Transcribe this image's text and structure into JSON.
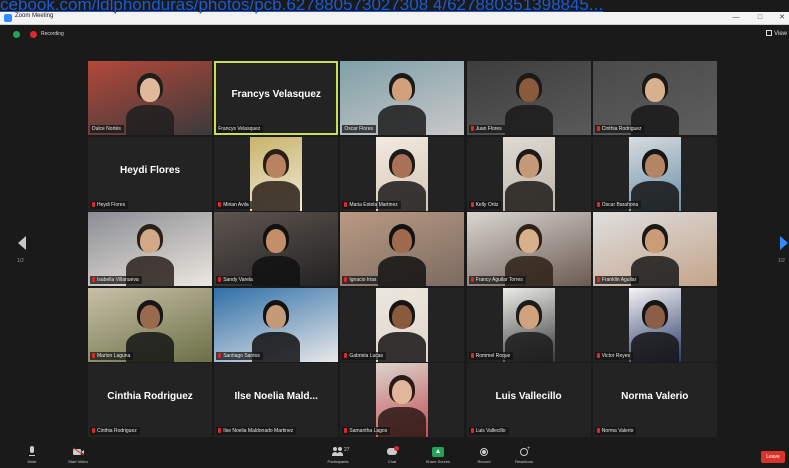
{
  "url_overlay": "cebook.com/ldlphonduras/photos/pcb.627880573027308 4/627880351398845...",
  "window": {
    "title": "Zoom Meeting",
    "min": "—",
    "max": "□",
    "close": "✕"
  },
  "topbar": {
    "recording": "Recording",
    "view": "View"
  },
  "pages": {
    "left": "1/2",
    "right": "1/2"
  },
  "participants": [
    {
      "name": "Dulce Nortés",
      "video": true,
      "muted": false
    },
    {
      "name": "Francys Velasquez",
      "display": "Francys Velasquez",
      "video": false,
      "muted": false,
      "active": true
    },
    {
      "name": "Oscar Flores",
      "video": true,
      "muted": false
    },
    {
      "name": "Juan Flores",
      "video": true,
      "muted": true
    },
    {
      "name": "Cinthia Rodriguez",
      "video": true,
      "muted": true
    },
    {
      "name": "Heydi Flores",
      "display": "Heydi Flores",
      "video": false,
      "muted": true
    },
    {
      "name": "Mirian Avila",
      "video": true,
      "muted": true
    },
    {
      "name": "Maria Estela Martinez",
      "video": true,
      "muted": true
    },
    {
      "name": "Kelly Ortiz",
      "video": true,
      "muted": true
    },
    {
      "name": "Oscar Barahona",
      "video": true,
      "muted": true
    },
    {
      "name": "Isabella Villanueva",
      "video": true,
      "muted": true
    },
    {
      "name": "Sandy Varela",
      "video": true,
      "muted": true
    },
    {
      "name": "Ignacio Irias",
      "video": true,
      "muted": true
    },
    {
      "name": "Francy Aguilar Torres",
      "video": true,
      "muted": true
    },
    {
      "name": "Franklin Aguilar",
      "video": true,
      "muted": true
    },
    {
      "name": "Marlon Laguna",
      "video": true,
      "muted": true
    },
    {
      "name": "Santiago Santos",
      "video": true,
      "muted": true
    },
    {
      "name": "Gabriela Lucas",
      "video": true,
      "muted": true
    },
    {
      "name": "Rommel Roque",
      "video": true,
      "muted": true
    },
    {
      "name": "Victor Reyes",
      "video": true,
      "muted": true
    },
    {
      "name": "Cinthia Rodriguez",
      "display": "Cinthia Rodriguez",
      "video": false,
      "muted": true
    },
    {
      "name": "Ilse Noelia Maldonado Martinez",
      "display": "Ilse Noelia Mald...",
      "video": false,
      "muted": true
    },
    {
      "name": "Samantha Lagos",
      "video": true,
      "muted": true
    },
    {
      "name": "Luis Vallecillo",
      "display": "Luis Vallecillo",
      "video": false,
      "muted": true
    },
    {
      "name": "Norma Valerio",
      "display": "Norma Valerio",
      "video": false,
      "muted": true
    }
  ],
  "toolbar": {
    "mute": "Mute",
    "video": "Start Video",
    "participants": "Participants",
    "participants_count": "27",
    "chat": "Chat",
    "share": "Share Screen",
    "record": "Record",
    "reactions": "Reactions",
    "leave": "Leave"
  }
}
